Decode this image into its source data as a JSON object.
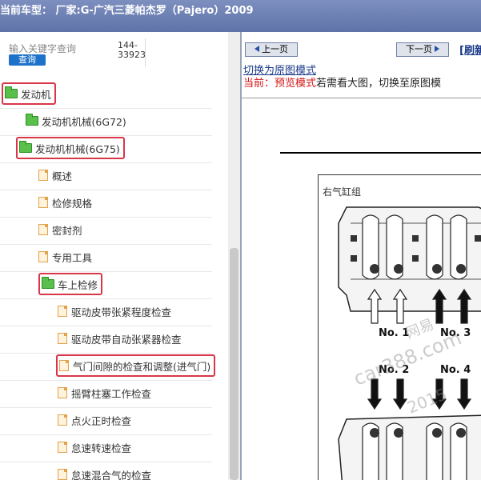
{
  "title": "当前车型：  厂家:G-广汽三菱帕杰罗（Pajero）2009",
  "left_panel": {
    "search_placeholder": "输入关键字查询",
    "query_label": "查询",
    "code": "144-33923",
    "tree": [
      {
        "label": "发动机",
        "icon": "folder-icon",
        "indent": 0,
        "highlighted": true
      },
      {
        "label": "发动机机械(6G72)",
        "icon": "folder-icon",
        "indent": 1,
        "highlighted": false
      },
      {
        "label": "发动机机械(6G75)",
        "icon": "folder-icon",
        "indent": 1,
        "highlighted": true
      },
      {
        "label": "概述",
        "icon": "page-icon",
        "indent": 2,
        "highlighted": false
      },
      {
        "label": "检修规格",
        "icon": "page-icon",
        "indent": 2,
        "highlighted": false
      },
      {
        "label": "密封剂",
        "icon": "page-icon",
        "indent": 2,
        "highlighted": false
      },
      {
        "label": "专用工具",
        "icon": "page-icon",
        "indent": 2,
        "highlighted": false
      },
      {
        "label": "车上检修",
        "icon": "folder-icon",
        "indent": 2,
        "highlighted": true
      },
      {
        "label": "驱动皮带张紧程度检查",
        "icon": "page-icon",
        "indent": 3,
        "highlighted": false
      },
      {
        "label": "驱动皮带自动张紧器检查",
        "icon": "page-icon",
        "indent": 3,
        "highlighted": false
      },
      {
        "label": "气门间隙的检查和调整(进气门)",
        "icon": "page-icon",
        "indent": 3,
        "highlighted": true
      },
      {
        "label": "摇臂柱塞工作检查",
        "icon": "page-icon",
        "indent": 3,
        "highlighted": false
      },
      {
        "label": "点火正时检查",
        "icon": "page-icon",
        "indent": 3,
        "highlighted": false
      },
      {
        "label": "怠速转速检查",
        "icon": "page-icon",
        "indent": 3,
        "highlighted": false
      },
      {
        "label": "怠速混合气的检查",
        "icon": "page-icon",
        "indent": 3,
        "highlighted": false
      }
    ]
  },
  "right_panel": {
    "prev_label": "上一页",
    "next_label": "下一页",
    "refresh_label": "[刷新",
    "switch_link": "切换为原图模式",
    "mode_prefix": "当前：",
    "mode_name": "预览模式",
    "mode_hint": "若需看大图，切换至原图模",
    "figure": {
      "title": "右气缸组",
      "cylinders": [
        "No. 1",
        "No. 3",
        "No. 2",
        "No. 4"
      ],
      "watermark": "car388.com",
      "watermark_small": "网易",
      "watermark_year": "2015"
    }
  },
  "colors": {
    "highlight": "#d9364a",
    "link": "#1a3a8a",
    "mode_red": "#d21414",
    "titlebar": "#6b7fb3"
  }
}
